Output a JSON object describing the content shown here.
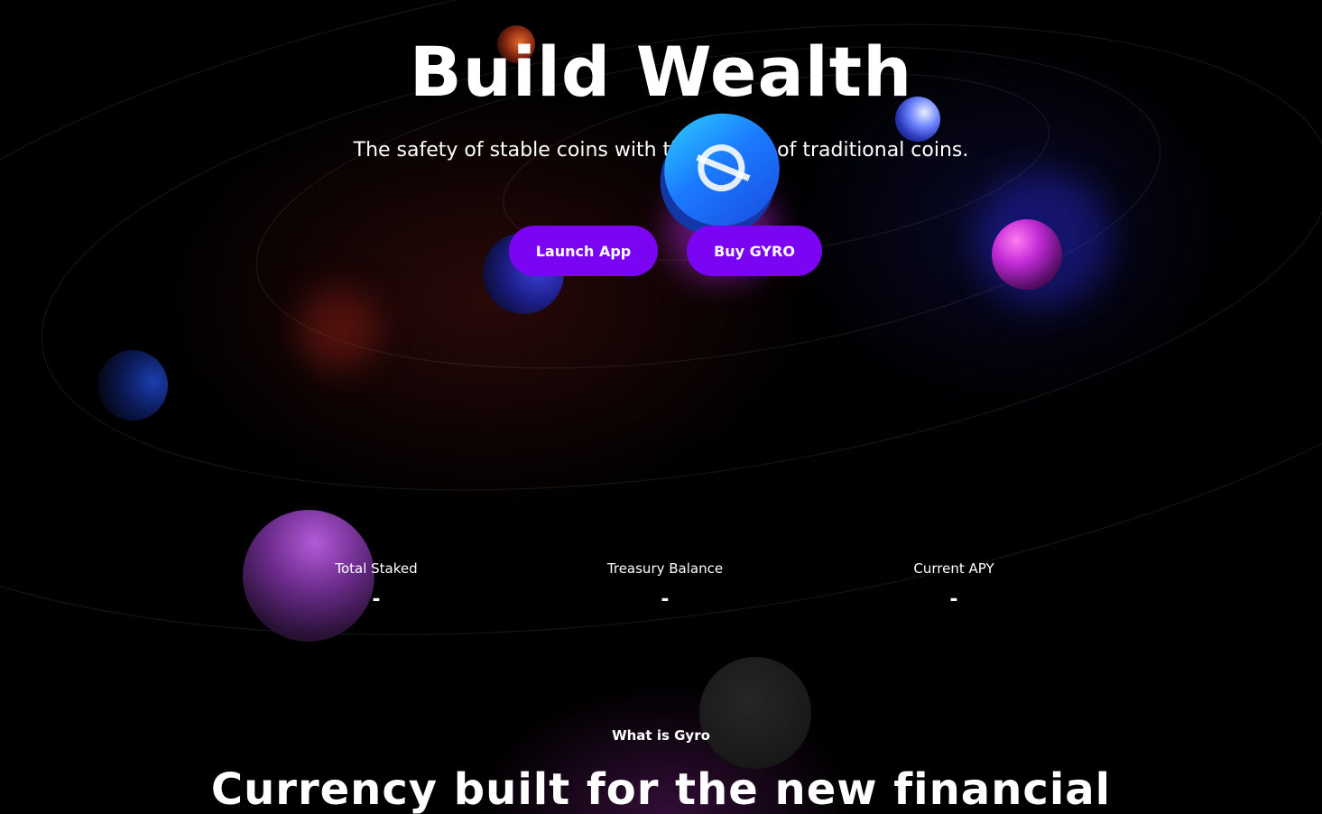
{
  "hero": {
    "title": "Build Wealth",
    "subtitle": "The safety of stable coins with the growth of traditional coins.",
    "buttons": {
      "launch_app": "Launch App",
      "buy_gyro": "Buy GYRO"
    }
  },
  "stats": [
    {
      "label": "Total Staked",
      "value": "-"
    },
    {
      "label": "Treasury Balance",
      "value": "-"
    },
    {
      "label": "Current APY",
      "value": "-"
    }
  ],
  "section": {
    "eyebrow": "What is Gyro",
    "heading": "Currency built for the new financial"
  },
  "colors": {
    "background": "#000000",
    "button": "#7b05f2",
    "text": "#ffffff"
  },
  "icons": {
    "coin": "gyro-coin-icon"
  }
}
